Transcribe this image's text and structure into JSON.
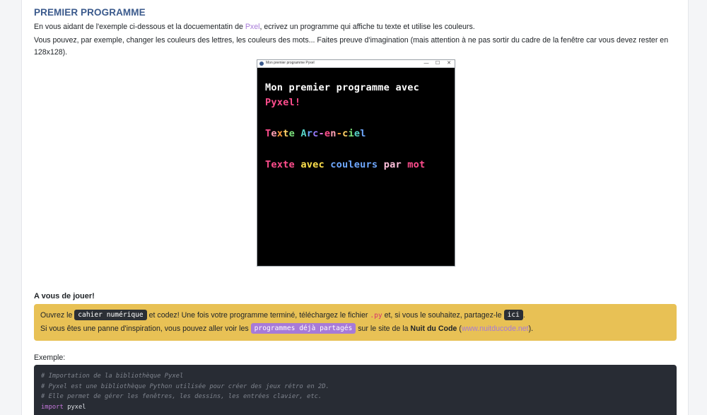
{
  "section_title": "PREMIER PROGRAMME",
  "intro": {
    "part1": "En vous aidant de l'exemple ci-dessous et la docuementatin de ",
    "link": "Pxel",
    "part2": ", ecrivez un programme qui affiche tu texte et utilise les couleurs."
  },
  "instructions": "Vous pouvez, par exemple, changer les couleurs des lettres, les couleurs des mots... Faites preuve d'imagination (mais attention à ne pas sortir du cadre de la fenêtre car vous devez rester en 128x128).",
  "pyxel_window": {
    "title": "Mon premier programme Pyxel",
    "minimize": "—",
    "maximize": "☐",
    "close": "✕",
    "lines": [
      {
        "text": "Mon premier programme avec",
        "color": "#ffffff"
      },
      {
        "text": "Pyxel!",
        "color": "#ff4d8d"
      },
      {
        "text": "Texte Arc-en-ciel",
        "color": "rainbow"
      },
      {
        "text": "Texte avec couleurs par mot",
        "color": "per-word"
      }
    ],
    "rainbow_colors": [
      "#ff4d8d",
      "#ffa0b4",
      "#ff9d3c",
      "#ffd166",
      "#7be07b",
      "#57d3c8",
      "#6fa8ff",
      "#9a7cff",
      "#e07be0"
    ],
    "word_colors": [
      "#ff4d8d",
      "#ffe14d",
      "#6fa8ff",
      "#ffc0dc",
      "#ff4d8d"
    ]
  },
  "play_heading": "A vous de jouer!",
  "alert": {
    "l1_part1": "Ouvrez le ",
    "l1_kbd1": "cahier numérique",
    "l1_part2": " et codez! Une fois votre programme terminé, téléchargez le fichier ",
    "l1_code": ".py",
    "l1_part3": " et, si vous le souhaitez, partagez-le ",
    "l1_kbd2": "ici",
    "l1_part4": ".",
    "l2_part1": "Si vous êtes une panne d'inspiration, vous pouvez aller voir les ",
    "l2_kbd": "programmes déjà partagés",
    "l2_part2": " sur le site de la ",
    "l2_bold": "Nuit du Code",
    "l2_part3": " (",
    "l2_link": "www.nuitducode.net",
    "l2_part4": ")."
  },
  "example_label": "Exemple:",
  "code": {
    "line1": "# Importation de la bibliothèque Pyxel",
    "line2": "# Pyxel est une bibliothèque Python utilisée pour créer des jeux rétro en 2D.",
    "line3": "# Elle permet de gérer les fenêtres, les dessins, les entrées clavier, etc.",
    "line4_kw": "import",
    "line4_rest": " pyxel"
  }
}
